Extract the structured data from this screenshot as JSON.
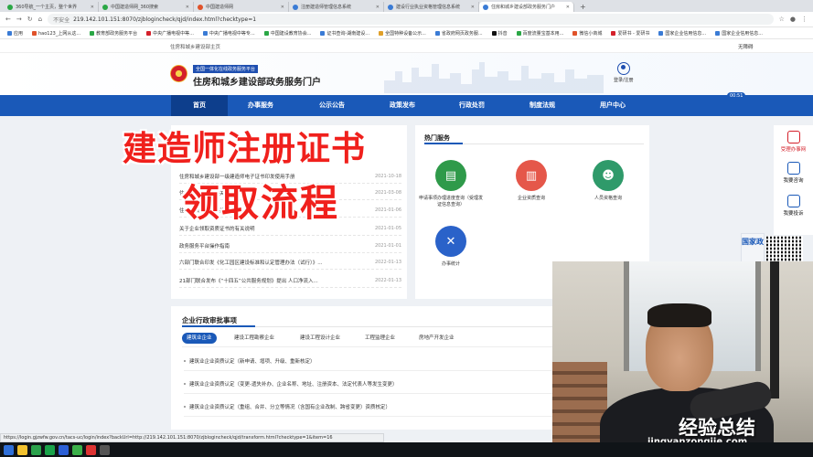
{
  "browser": {
    "tabs": [
      {
        "label": "360导航_一个主页，整个世界",
        "color": "#2aa745"
      },
      {
        "label": "中国建造师网_360搜索",
        "color": "#2aa745"
      },
      {
        "label": "中国建造师网",
        "color": "#e0522a"
      },
      {
        "label": "注册建造师管理信息系统",
        "color": "#3a7bd5"
      },
      {
        "label": "建设行业执业资格管理信息系统",
        "color": "#3a7bd5"
      },
      {
        "label": "住房和城乡建设部政务服务门户",
        "color": "#3a7bd5"
      }
    ],
    "url_insecure": "不安全",
    "url": "219.142.101.151:8070/zjblogincheck/qjd/index.html?checktype=1",
    "bookmarks": [
      "应用",
      "hao123_上网从这...",
      "教育部政务服务平台",
      "中央广播电视中等...",
      "中央广播电视中等专...",
      "中国建设教育协会...",
      "证书查询-湖南建设...",
      "全国特种设备公示...",
      "省政府网页政务服...",
      "抖音",
      "百度流量宝基本用...",
      "微信小商城",
      "爱研书 - 爱研书",
      "国家企业信用信息...",
      "国家企业信用信息..."
    ]
  },
  "site": {
    "topbar_left": "住房和城乡建设部主页",
    "topbar_right": "无障碍",
    "subtitle": "全国一体化在线政务服务平台",
    "title": "住房和城乡建设部政务服务门户",
    "login_label": "登录/注册",
    "nav": [
      "首页",
      "办事服务",
      "公示公告",
      "政策发布",
      "行政处罚",
      "制度法规",
      "用户中心"
    ],
    "news": [
      {
        "title": "住房和城乡建设部一级建造师电子证书印发使用手册",
        "date": "2021-10-18"
      },
      {
        "title": "住房和城乡建设部关于...",
        "date": "2021-03-08"
      },
      {
        "title": "住房和城乡建设部关于...",
        "date": "2021-01-06"
      },
      {
        "title": "关于企业领取资质证书的有关说明",
        "date": "2021-01-05"
      },
      {
        "title": "政务服务平台操作指南",
        "date": "2021-01-01"
      },
      {
        "title": "六部门联合印发《化工园区建设标准和认定管理办法（试行）》...",
        "date": "2022-01-13"
      },
      {
        "title": "21部门联合发布《“十四五”公共服务规划》提出 人口净流入...",
        "date": "2022-01-13"
      }
    ],
    "hot": {
      "title": "热门服务",
      "items": [
        {
          "label": "申请事项办理进度查询（受理发证信息查询）",
          "color": "#2f9a4a",
          "glyph": "▤"
        },
        {
          "label": "企业资质查询",
          "color": "#e5574a",
          "glyph": "▥"
        },
        {
          "label": "人员资格查询",
          "color": "#2f9a6a",
          "glyph": "☻"
        },
        {
          "label": "办事统计",
          "color": "#2a62c9",
          "glyph": "✕"
        }
      ]
    },
    "approval": {
      "title": "企业行政审批事项",
      "tabs": [
        "建筑业企业",
        "建设工程勘察企业",
        "建设工程设计企业",
        "工程监理企业",
        "房地产开发企业"
      ],
      "rows": [
        "建筑业企业资质认定（新申请、增项、升级、重新核定）",
        "建筑业企业资质认定（变更-遗失补办、企业名称、地址、注册资本、法定代表人等发生变更）",
        "建筑业企业资质认定（重组、合并、分立等情况（含国有企业改制、跨省变更）资质核定）"
      ]
    },
    "side_tools": [
      "受理办事网",
      "我要咨询",
      "我要投诉"
    ],
    "side_badge": "国家政"
  },
  "overlay": {
    "line1": "建造师注册证书",
    "line2": "领取流程"
  },
  "watermark": {
    "line1": "经验总结",
    "line2": "jingyanzongjie.com"
  },
  "webcam": {
    "time_badge": "00:51"
  },
  "status_url": "https://login.gjzwfw.gov.cn/tacs-uc/login/index?backUrl=http://219.142.101.151:8070/zjblogincheck/qjd/transform.html?checktype=1&item=16"
}
